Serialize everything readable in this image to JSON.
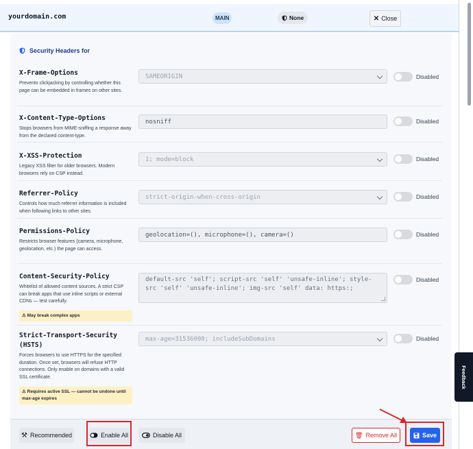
{
  "header": {
    "domain": "yourdomain.com",
    "branch_badge": "MAIN",
    "preset_badge": "None",
    "close_label": "Close"
  },
  "section": {
    "title": "Security Headers for"
  },
  "headers": [
    {
      "name": "X-Frame-Options",
      "description": "Prevents clickjacking by controlling whether this page can be embedded in frames on other sites.",
      "control": "select",
      "value": "SAMEORIGIN",
      "status": "Disabled"
    },
    {
      "name": "X-Content-Type-Options",
      "description": "Stops browsers from MIME-sniffing a response away from the declared content-type.",
      "control": "input",
      "value": "nosniff",
      "status": "Disabled"
    },
    {
      "name": "X-XSS-Protection",
      "description": "Legacy XSS filter for older browsers. Modern browsers rely on CSP instead.",
      "control": "select",
      "value": "1; mode=block",
      "status": "Disabled"
    },
    {
      "name": "Referrer-Policy",
      "description": "Controls how much referrer information is included when following links to other sites.",
      "control": "select",
      "value": "strict-origin-when-cross-origin",
      "status": "Disabled"
    },
    {
      "name": "Permissions-Policy",
      "description": "Restricts browser features (camera, microphone, geolocation, etc.) the page can access.",
      "control": "input",
      "value": "geolocation=(), microphone=(), camera=()",
      "status": "Disabled"
    },
    {
      "name": "Content-Security-Policy",
      "description": "Whitelist of allowed content sources. A strict CSP can break apps that use inline scripts or external CDNs — test carefully.",
      "control": "textarea",
      "value": "default-src 'self'; script-src 'self' 'unsafe-inline'; style-src 'self' 'unsafe-inline'; img-src 'self' data: https:;",
      "warning": "May break complex apps",
      "status": "Disabled"
    },
    {
      "name_line1": "Strict-Transport-Security",
      "name_line2": "(HSTS)",
      "description": "Forces browsers to use HTTPS for the specified duration. Once set, browsers will refuse HTTP connections. Only enable on domains with a valid SSL certificate.",
      "control": "select",
      "value": "max-age=31536000; includeSubDomains",
      "warning": "Requires active SSL — cannot be undone until max-age expires",
      "status": "Disabled"
    }
  ],
  "footer": {
    "recommended_label": "Recommended",
    "enable_all_label": "Enable All",
    "disable_all_label": "Disable All",
    "remove_all_label": "Remove All",
    "save_label": "Save"
  },
  "feedback_label": "Feedback",
  "colors": {
    "accent": "#2563eb",
    "danger": "#dc2626",
    "warning_bg": "#fdf0c4",
    "header_bg": "#eff6ff"
  }
}
